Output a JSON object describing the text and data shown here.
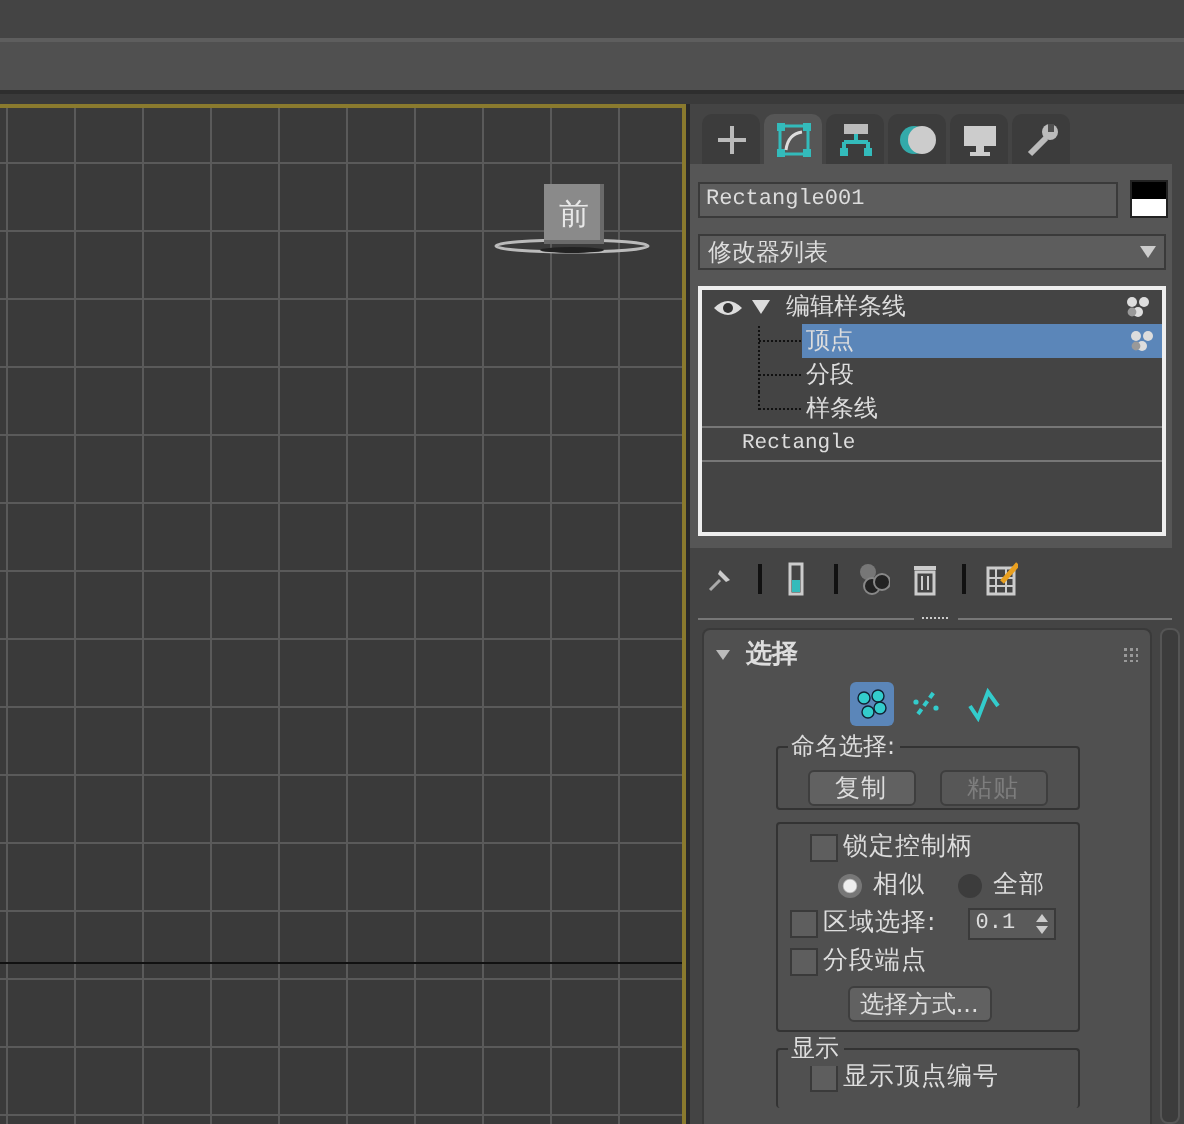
{
  "viewport": {
    "viewcube_label": "前"
  },
  "command_panel": {
    "tabs": [
      {
        "kind": "create",
        "selected": false
      },
      {
        "kind": "modify",
        "selected": true
      },
      {
        "kind": "hierarchy",
        "selected": false
      },
      {
        "kind": "motion",
        "selected": false
      },
      {
        "kind": "display",
        "selected": false
      },
      {
        "kind": "utilities",
        "selected": false
      }
    ],
    "object_name": "Rectangle001",
    "modifier_list": "修改器列表",
    "stack": [
      {
        "label": "编辑样条线",
        "expanded": true,
        "visible": true,
        "children": [
          {
            "label": "顶点",
            "selected": true
          },
          {
            "label": "分段",
            "selected": false
          },
          {
            "label": "样条线",
            "selected": false
          }
        ]
      },
      {
        "label": "Rectangle"
      }
    ]
  },
  "rollout": {
    "title": "选择",
    "expanded": true,
    "subobjects": [
      {
        "kind": "vertex",
        "selected": true
      },
      {
        "kind": "segment",
        "selected": false
      },
      {
        "kind": "spline",
        "selected": false
      }
    ],
    "named_selection": {
      "title": "命名选择:",
      "buttons": [
        {
          "label": "复制",
          "disabled": false
        },
        {
          "label": "粘贴",
          "disabled": true
        }
      ]
    },
    "lock_handles": {
      "label": "锁定控制柄",
      "checked": false
    },
    "radios": [
      {
        "label": "相似",
        "selected": true
      },
      {
        "label": "全部",
        "selected": false
      }
    ],
    "area_selection": {
      "label": "区域选择:",
      "checked": false,
      "value": "0.1"
    },
    "segment_end": {
      "label": "分段端点",
      "checked": false
    },
    "select_by": "选择方式...",
    "display": {
      "title": "显示",
      "show_vertex_numbers": {
        "label": "显示顶点编号",
        "checked": false
      }
    }
  }
}
